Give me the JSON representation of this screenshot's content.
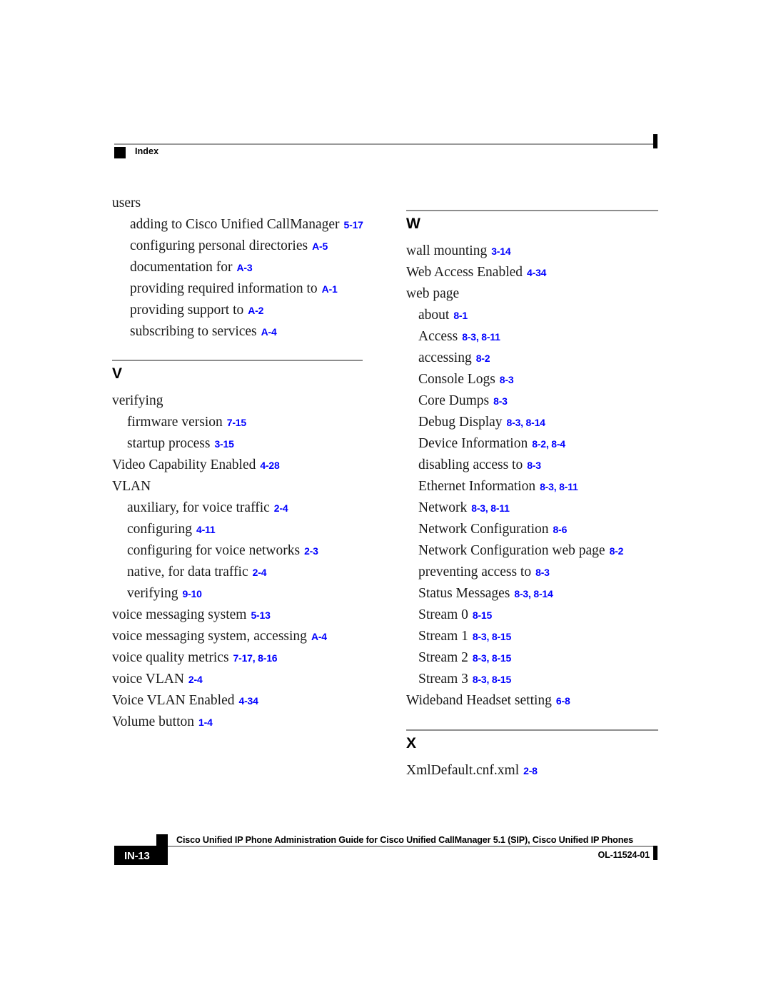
{
  "header": {
    "label": "Index"
  },
  "columns": {
    "left": [
      {
        "type": "entries",
        "items": [
          {
            "level": 0,
            "text": "users",
            "ref": ""
          },
          {
            "level": 1,
            "text": "adding to Cisco Unified CallManager",
            "ref": "5-17"
          },
          {
            "level": 1,
            "text": "configuring personal directories",
            "ref": "A-5"
          },
          {
            "level": 1,
            "text": "documentation for",
            "ref": "A-3"
          },
          {
            "level": 1,
            "text": "providing required information to",
            "ref": "A-1"
          },
          {
            "level": 1,
            "text": "providing support to",
            "ref": "A-2"
          },
          {
            "level": 1,
            "text": "subscribing to services",
            "ref": "A-4"
          }
        ]
      },
      {
        "type": "section",
        "letter": "V",
        "items": [
          {
            "level": 0,
            "text": "verifying",
            "ref": ""
          },
          {
            "level": 1,
            "tight": true,
            "text": "firmware version",
            "ref": "7-15"
          },
          {
            "level": 1,
            "tight": true,
            "text": "startup process",
            "ref": "3-15"
          },
          {
            "level": 0,
            "text": "Video Capability Enabled",
            "ref": "4-28"
          },
          {
            "level": 0,
            "text": "VLAN",
            "ref": ""
          },
          {
            "level": 1,
            "tight": true,
            "text": "auxiliary, for voice traffic",
            "ref": "2-4"
          },
          {
            "level": 1,
            "tight": true,
            "text": "configuring",
            "ref": "4-11"
          },
          {
            "level": 1,
            "tight": true,
            "text": "configuring for voice networks",
            "ref": "2-3"
          },
          {
            "level": 1,
            "tight": true,
            "text": "native, for data traffic",
            "ref": "2-4"
          },
          {
            "level": 1,
            "tight": true,
            "text": "verifying",
            "ref": "9-10"
          },
          {
            "level": 0,
            "text": "voice messaging system",
            "ref": "5-13"
          },
          {
            "level": 0,
            "text": "voice messaging system, accessing",
            "ref": "A-4"
          },
          {
            "level": 0,
            "text": "voice quality metrics",
            "ref": "7-17, 8-16"
          },
          {
            "level": 0,
            "text": "voice VLAN",
            "ref": "2-4"
          },
          {
            "level": 0,
            "text": "Voice VLAN Enabled",
            "ref": "4-34"
          },
          {
            "level": 0,
            "text": "Volume button",
            "ref": "1-4"
          }
        ]
      }
    ],
    "right": [
      {
        "type": "section",
        "letter": "W",
        "items": [
          {
            "level": 0,
            "text": "wall mounting",
            "ref": "3-14"
          },
          {
            "level": 0,
            "text": "Web Access Enabled",
            "ref": "4-34"
          },
          {
            "level": 0,
            "text": "web page",
            "ref": ""
          },
          {
            "level": 1,
            "text": "about",
            "ref": "8-1"
          },
          {
            "level": 1,
            "text": "Access",
            "ref": "8-3, 8-11"
          },
          {
            "level": 1,
            "text": "accessing",
            "ref": "8-2"
          },
          {
            "level": 1,
            "text": "Console Logs",
            "ref": "8-3"
          },
          {
            "level": 1,
            "text": "Core Dumps",
            "ref": "8-3"
          },
          {
            "level": 1,
            "text": "Debug Display",
            "ref": "8-3, 8-14"
          },
          {
            "level": 1,
            "text": "Device Information",
            "ref": "8-2, 8-4"
          },
          {
            "level": 1,
            "text": "disabling access to",
            "ref": "8-3"
          },
          {
            "level": 1,
            "text": "Ethernet Information",
            "ref": "8-3, 8-11"
          },
          {
            "level": 1,
            "text": "Network",
            "ref": "8-3, 8-11"
          },
          {
            "level": 1,
            "text": "Network Configuration",
            "ref": "8-6"
          },
          {
            "level": 1,
            "text": "Network Configuration web page",
            "ref": "8-2"
          },
          {
            "level": 1,
            "text": "preventing access to",
            "ref": "8-3"
          },
          {
            "level": 1,
            "text": "Status Messages",
            "ref": "8-3, 8-14"
          },
          {
            "level": 1,
            "text": "Stream 0",
            "ref": "8-15"
          },
          {
            "level": 1,
            "text": "Stream 1",
            "ref": "8-3, 8-15"
          },
          {
            "level": 1,
            "text": "Stream 2",
            "ref": "8-3, 8-15"
          },
          {
            "level": 1,
            "text": "Stream 3",
            "ref": "8-3, 8-15"
          },
          {
            "level": 0,
            "text": "Wideband Headset setting",
            "ref": "6-8"
          }
        ]
      },
      {
        "type": "section",
        "letter": "X",
        "items": [
          {
            "level": 0,
            "text": "XmlDefault.cnf.xml",
            "ref": "2-8"
          }
        ]
      }
    ]
  },
  "footer": {
    "page_tag": "IN-13",
    "title": "Cisco Unified IP Phone Administration Guide for Cisco Unified CallManager 5.1 (SIP), Cisco Unified IP Phones",
    "doc_id": "OL-11524-01"
  },
  "colors": {
    "reference_blue": "#0000ff",
    "rule_gray": "#9a9a9a",
    "tag_black": "#000000"
  }
}
